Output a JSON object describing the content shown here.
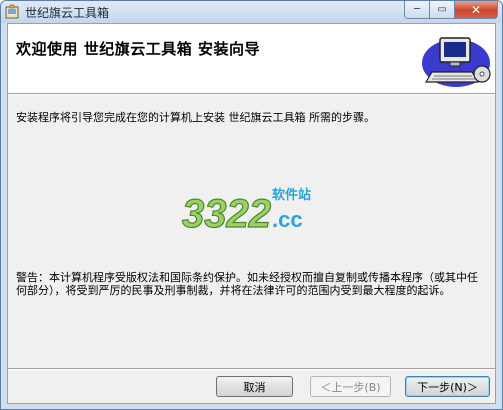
{
  "window": {
    "title": "世纪旗云工具箱",
    "controls": {
      "minimize": "─",
      "maximize": "▭",
      "close": "✕"
    }
  },
  "header": {
    "title": "欢迎使用 世纪旗云工具箱 安装向导",
    "art_icon": "computer-setup-icon"
  },
  "body": {
    "intro": "安装程序将引导您完成在您的计算机上安装 世纪旗云工具箱 所需的步骤。",
    "watermark": {
      "digits": "3322",
      "suffix": ".cc",
      "tag": "软件站"
    },
    "warning": "警告：本计算机程序受版权法和国际条约保护。如未经授权而擅自复制或传播本程序（或其中任何部分），将受到严厉的民事及刑事制裁，并将在法律许可的范围内受到最大程度的起诉。"
  },
  "footer": {
    "cancel_label": "取消",
    "back_label": "＜上一步(B)",
    "next_label": "下一步(N)＞"
  },
  "colors": {
    "frame": "#cfdff0",
    "close": "#c8452d",
    "panel": "#f0f0f0",
    "default_button_border": "#3c7fb1"
  }
}
